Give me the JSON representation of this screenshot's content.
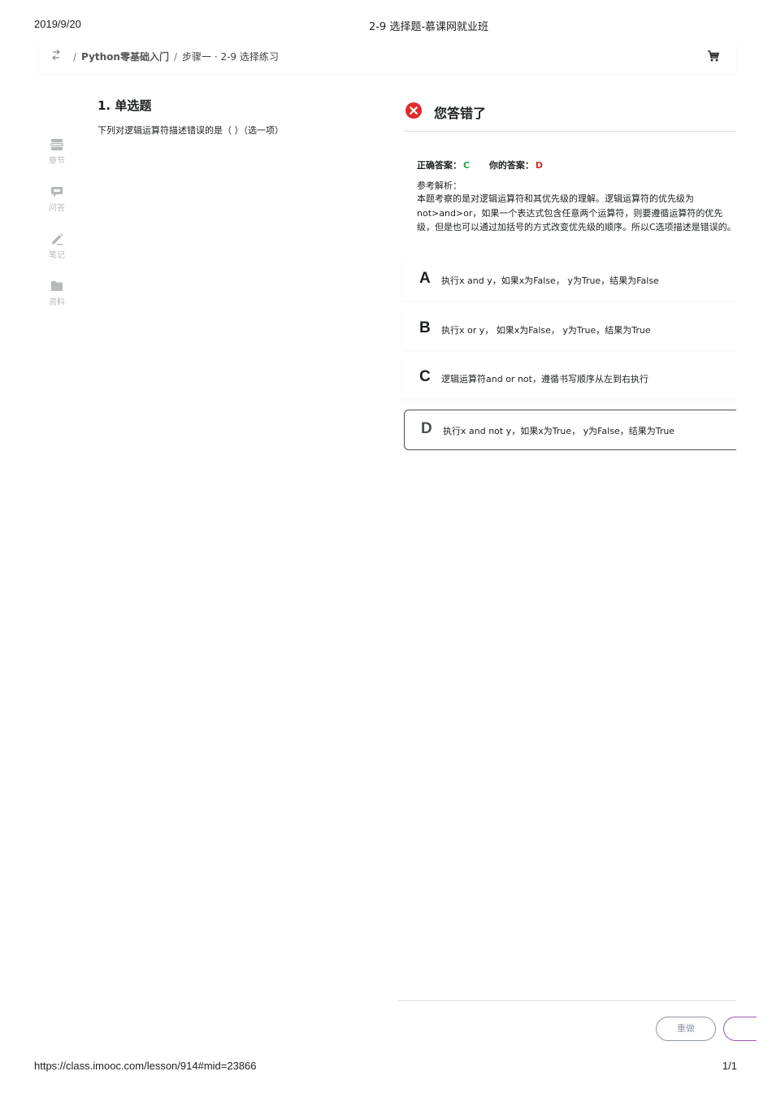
{
  "print": {
    "date": "2019/9/20",
    "title": "2-9 选择题-慕课网就业班",
    "url": "https://class.imooc.com/lesson/914#mid=23866",
    "page": "1/1"
  },
  "breadcrumb": {
    "course": "Python零基础入门",
    "lesson": "步骤一 · 2-9 选择练习",
    "separator": "/"
  },
  "sidebar": {
    "items": [
      {
        "label": "章节",
        "icon": "chapter-list-icon"
      },
      {
        "label": "问答",
        "icon": "qa-bubble-icon"
      },
      {
        "label": "笔记",
        "icon": "pencil-icon"
      },
      {
        "label": "资料",
        "icon": "folder-icon"
      }
    ]
  },
  "question": {
    "title": "1. 单选题",
    "text": "下列对逻辑运算符描述错误的是（ ）（选一项）"
  },
  "result": {
    "title": "您答错了",
    "correct_label": "正确答案：",
    "correct_value": "C",
    "your_label": "你的答案：",
    "your_value": "D",
    "analysis_label": "参考解析：",
    "analysis_text": "本题考察的是对逻辑运算符和其优先级的理解。逻辑运算符的优先级为not>and>or，如果一个表达式包含任意两个运算符，则要遵循运算符的优先级，但是也可以通过加括号的方式改变优先级的顺序。所以C选项描述是错误的。"
  },
  "options": [
    {
      "letter": "A",
      "text": "执行x and y，如果x为False， y为True，结果为False"
    },
    {
      "letter": "B",
      "text": "执行x or y， 如果x为False， y为True，结果为True"
    },
    {
      "letter": "C",
      "text": "逻辑运算符and or not，遵循书写顺序从左到右执行"
    },
    {
      "letter": "D",
      "text": "执行x and not y，如果x为True， y为False，结果为True"
    }
  ],
  "actions": {
    "redo_label": "重做"
  },
  "colors": {
    "correct": "#2aa04a",
    "wrong": "#e02b2b",
    "next_button_border": "#9b59b6"
  }
}
